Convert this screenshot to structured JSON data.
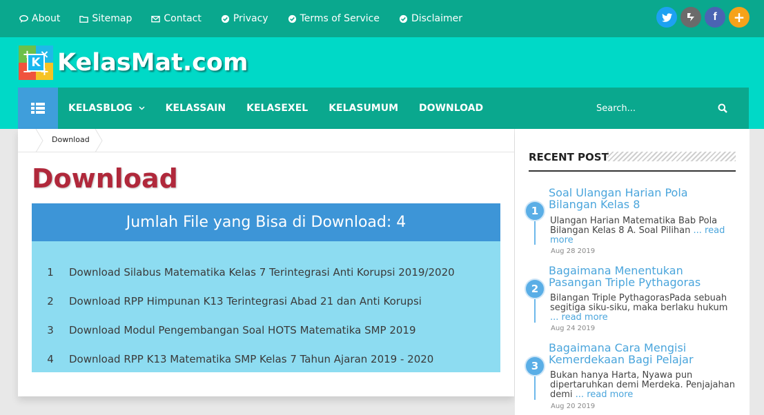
{
  "topnav": {
    "items": [
      {
        "label": "About",
        "icon": "comments-icon"
      },
      {
        "label": "Sitemap",
        "icon": "folder-icon"
      },
      {
        "label": "Contact",
        "icon": "envelope-icon"
      },
      {
        "label": "Privacy",
        "icon": "check-circle-icon"
      },
      {
        "label": "Terms of Service",
        "icon": "check-circle-icon"
      },
      {
        "label": "Disclaimer",
        "icon": "check-circle-icon"
      }
    ],
    "social": [
      {
        "name": "twitter-icon",
        "glyph": "t",
        "color": "#1da1f2"
      },
      {
        "name": "delicious-icon",
        "glyph": "✱",
        "color": "#6b6b6b"
      },
      {
        "name": "facebook-icon",
        "glyph": "f",
        "color": "#4a64b3"
      },
      {
        "name": "plus-icon",
        "glyph": "+",
        "color": "#f6a21a"
      }
    ]
  },
  "logo": {
    "text": "KelasMat.com",
    "tiles": [
      "+",
      "×",
      "−",
      "+"
    ],
    "center": "K"
  },
  "menu": {
    "items": [
      {
        "label": "KELASBLOG",
        "dropdown": true
      },
      {
        "label": "KELASSAIN"
      },
      {
        "label": "KELASEXEL"
      },
      {
        "label": "KELASUMUM"
      },
      {
        "label": "DOWNLOAD"
      }
    ],
    "search_placeholder": "Search..."
  },
  "breadcrumb": {
    "current": "Download"
  },
  "page": {
    "title": "Download",
    "box_heading": "Jumlah File yang Bisa di Download: 4",
    "downloads": [
      {
        "num": "1",
        "label": "Download Silabus Matematika Kelas 7 Terintegrasi Anti Korupsi 2019/2020"
      },
      {
        "num": "2",
        "label": "Download RPP Himpunan K13 Terintegrasi Abad 21 dan Anti Korupsi"
      },
      {
        "num": "3",
        "label": "Download Modul Pengembangan Soal HOTS Matematika SMP 2019"
      },
      {
        "num": "4",
        "label": "Download RPP K13 Matematika SMP Kelas 7 Tahun Ajaran 2019 - 2020"
      }
    ]
  },
  "sidebar": {
    "title": "RECENT POST",
    "posts": [
      {
        "num": "1",
        "title": "Soal Ulangan Harian Pola Bilangan Kelas 8",
        "excerpt": "Ulangan Harian Matematika Bab Pola Bilangan Kelas 8 A. Soal Pilihan",
        "more": "... read more",
        "date": "Aug 28 2019"
      },
      {
        "num": "2",
        "title": "Bagaimana Menentukan Pasangan Triple Pythagoras",
        "excerpt": "Bilangan Triple PythagorasPada sebuah segitiga siku-siku, maka berlaku hukum",
        "more": "... read more",
        "date": "Aug 24 2019"
      },
      {
        "num": "3",
        "title": "Bagaimana Cara Mengisi Kemerdekaan Bagi Pelajar",
        "excerpt": "Bukan hanya Harta, Nyawa pun dipertaruhkan demi Merdeka. Penjajahan demi",
        "more": "... read more",
        "date": "Aug 20 2019"
      }
    ]
  },
  "colors": {
    "topbar": "#0aa88e",
    "band": "#00d9c7",
    "title_red": "#b0283b",
    "box_head": "#3d95d7",
    "box_body": "#8ddcf1",
    "link_blue": "#4aa5dc"
  }
}
